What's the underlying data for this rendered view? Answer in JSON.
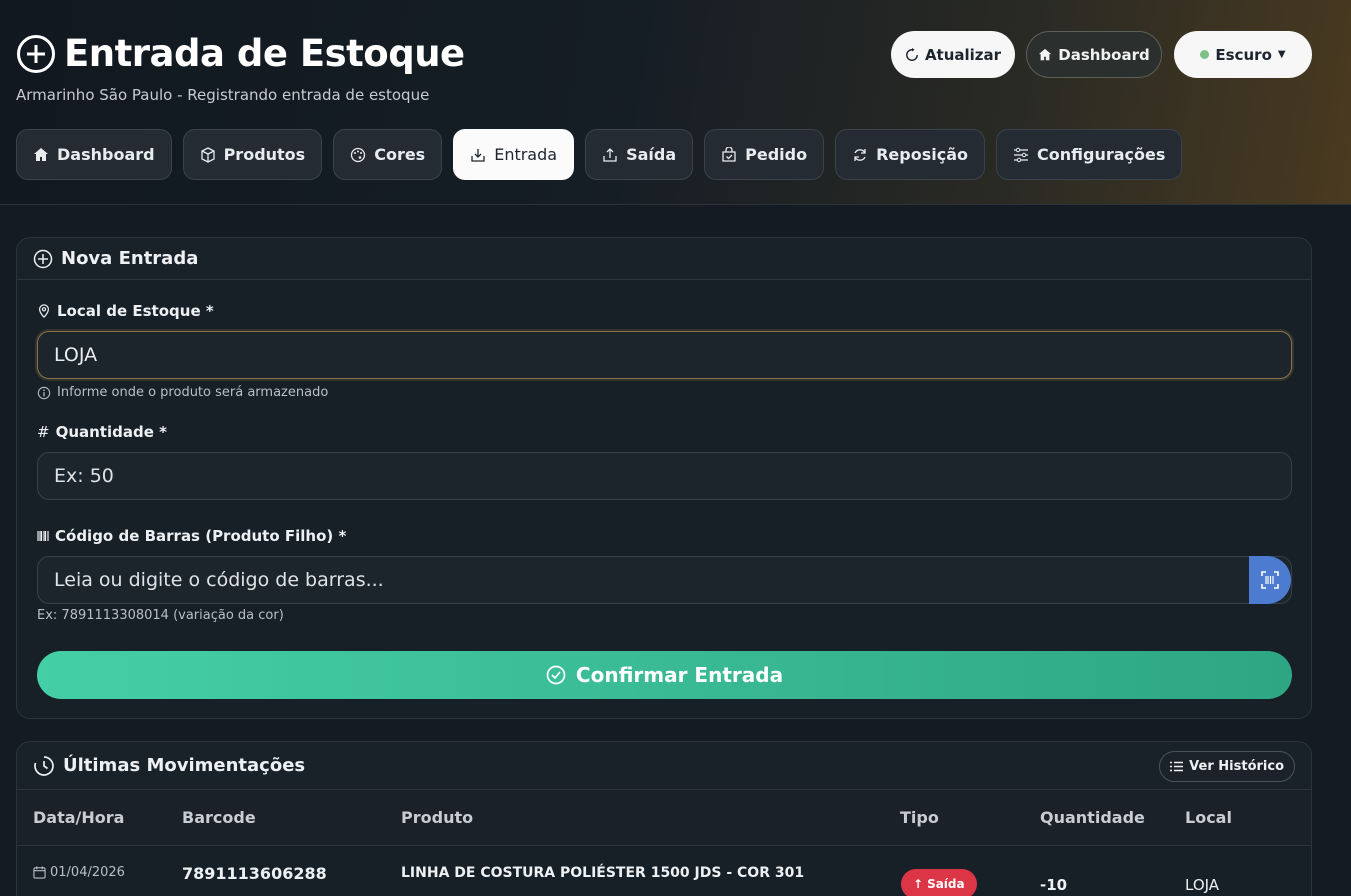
{
  "header": {
    "title": "Entrada de Estoque",
    "subtitle": "Armarinho São Paulo - Registrando entrada de estoque",
    "refresh_label": "Atualizar",
    "dashboard_label": "Dashboard",
    "theme_label": "Escuro"
  },
  "nav": {
    "tabs": [
      {
        "label": "Dashboard",
        "icon": "home-icon"
      },
      {
        "label": "Produtos",
        "icon": "box-icon"
      },
      {
        "label": "Cores",
        "icon": "palette-icon"
      },
      {
        "label": "Entrada",
        "icon": "box-arrow-in-icon"
      },
      {
        "label": "Saída",
        "icon": "box-arrow-up-icon"
      },
      {
        "label": "Pedido",
        "icon": "bag-check-icon"
      },
      {
        "label": "Reposição",
        "icon": "arrow-repeat-icon"
      },
      {
        "label": "Configurações",
        "icon": "sliders-icon"
      }
    ],
    "active": "Entrada"
  },
  "form": {
    "title": "Nova Entrada",
    "local_label": "Local de Estoque *",
    "local_value": "LOJA",
    "local_hint": "Informe onde o produto será armazenado",
    "qty_label": "Quantidade *",
    "qty_placeholder": "Ex: 50",
    "barcode_label": "Código de Barras (Produto Filho) *",
    "barcode_placeholder": "Leia ou digite o código de barras...",
    "barcode_hint": "Ex: 7891113308014 (variação da cor)",
    "confirm_label": "Confirmar Entrada"
  },
  "movements": {
    "title": "Últimas Movimentações",
    "history_label": "Ver Histórico",
    "columns": [
      "Data/Hora",
      "Barcode",
      "Produto",
      "Tipo",
      "Quantidade",
      "Local"
    ],
    "rows": [
      {
        "date": "01/04/2026",
        "barcode": "7891113606288",
        "product": "LINHA DE COSTURA POLIÉSTER 1500 JDS - COR 301",
        "type": "Saída",
        "quantity": "-10",
        "local": "LOJA"
      }
    ]
  },
  "colors": {
    "accent_green": "#45cfa6",
    "danger": "#dc3545",
    "scan_blue": "#4d7bd0"
  }
}
